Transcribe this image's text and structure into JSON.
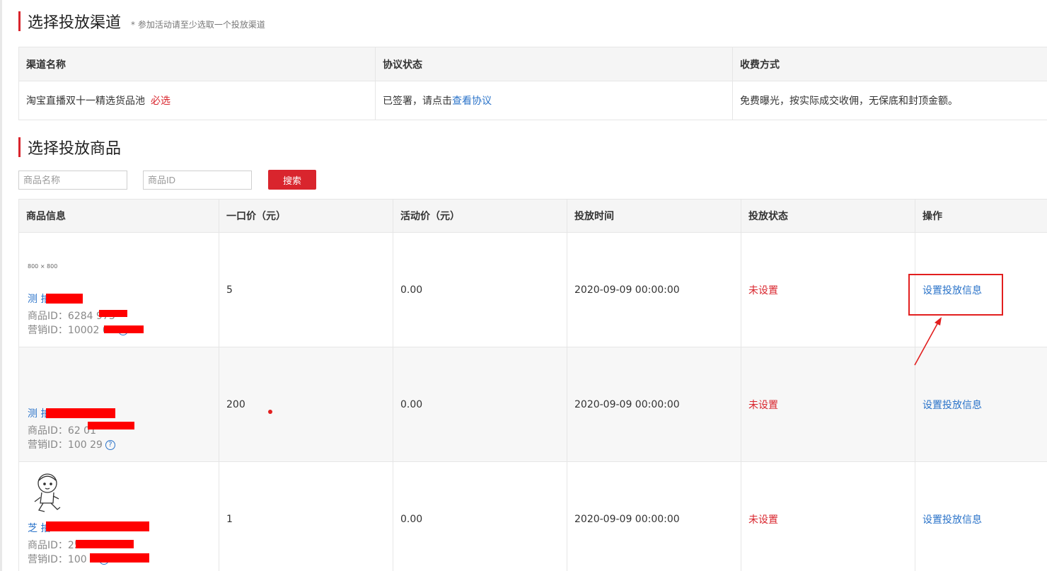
{
  "channel_section": {
    "title": "选择投放渠道",
    "hint": "* 参加活动请至少选取一个投放渠道",
    "headers": [
      "渠道名称",
      "协议状态",
      "收费方式"
    ],
    "row": {
      "name": "淘宝直播双十一精选货品池",
      "required": "必选",
      "agreement_prefix": "已签署，请点击",
      "agreement_link": "查看协议",
      "fee": "免费曝光，按实际成交收佣，无保底和封顶金额。"
    }
  },
  "product_section": {
    "title": "选择投放商品",
    "search": {
      "name_placeholder": "商品名称",
      "id_placeholder": "商品ID",
      "button": "搜索"
    },
    "headers": [
      "商品信息",
      "一口价（元）",
      "活动价（元）",
      "投放时间",
      "投放状态",
      "操作"
    ],
    "rows": [
      {
        "thumb_text": "800 × 800",
        "thumb_icon": "image-placeholder",
        "name_visible": "测 拍",
        "pid_label": "商品ID：",
        "pid_visible": "6284 973",
        "mid_label": "营销ID：",
        "mid_visible": "10002 00",
        "price": "5",
        "activity_price": "0.00",
        "time": "2020-09-09 00:00:00",
        "status": "未设置",
        "action": "设置投放信息"
      },
      {
        "thumb_text": "",
        "thumb_icon": "",
        "name_visible": "测 拍",
        "pid_label": "商品ID：",
        "pid_visible": "62 01",
        "mid_label": "营销ID：",
        "mid_visible": "100 29",
        "price": "200",
        "activity_price": "0.00",
        "time": "2020-09-09 00:00:00",
        "status": "未设置",
        "action": "设置投放信息"
      },
      {
        "thumb_text": "",
        "thumb_icon": "cartoon-child-sketch",
        "name_visible": "芝 拍",
        "pid_label": "商品ID：",
        "pid_visible": "25",
        "mid_label": "营销ID：",
        "mid_visible": "100 1",
        "price": "1",
        "activity_price": "0.00",
        "time": "2020-09-09 00:00:00",
        "status": "未设置",
        "action": "设置投放信息"
      }
    ]
  },
  "colors": {
    "accent_red": "#d9252d",
    "link_blue": "#2a73c9",
    "header_bg": "#f5f5f5"
  }
}
